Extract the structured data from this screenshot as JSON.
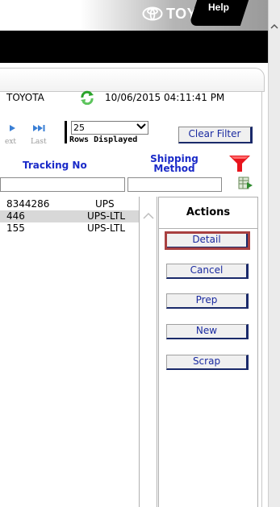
{
  "banner": {
    "logo_text": "TOYOTA",
    "help_label": "Help"
  },
  "info": {
    "company": "TOYOTA",
    "timestamp": "10/06/2015 04:11:41 PM"
  },
  "pager": {
    "next_label": "ext",
    "last_label": "Last",
    "rows_value": "25",
    "rows_label": "Rows Displayed",
    "clear_filter": "Clear Filter"
  },
  "columns": {
    "tracking": "Tracking No",
    "shipping": "Shipping Method"
  },
  "rows": [
    {
      "tracking": "8344286",
      "shipping": "UPS"
    },
    {
      "tracking": "446",
      "shipping": "UPS-LTL"
    },
    {
      "tracking": "155",
      "shipping": "UPS-LTL"
    }
  ],
  "actions": {
    "header": "Actions",
    "detail": "Detail",
    "cancel": "Cancel",
    "prep": "Prep",
    "new": "New",
    "scrap": "Scrap"
  },
  "colors": {
    "link_blue": "#1a2ac8",
    "button_text": "#1a2aa0",
    "highlight_outline": "#a84040",
    "selected_row": "#d8d8d8"
  }
}
